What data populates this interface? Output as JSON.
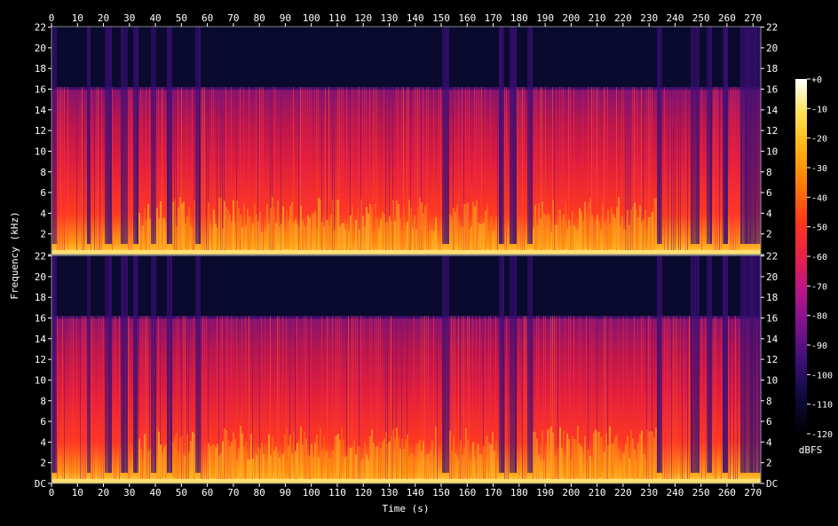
{
  "chart_data": {
    "type": "heatmap",
    "title": "",
    "xlabel": "Time (s)",
    "ylabel": "Frequency (kHz)",
    "colorbar_label": "dBFS",
    "xlim": [
      0,
      273
    ],
    "ylim": [
      0,
      22.05
    ],
    "x_ticks": [
      0,
      10,
      20,
      30,
      40,
      50,
      60,
      70,
      80,
      90,
      100,
      110,
      120,
      130,
      140,
      150,
      160,
      170,
      180,
      190,
      200,
      210,
      220,
      230,
      240,
      250,
      260,
      270
    ],
    "y_ticks": [
      {
        "value": 0,
        "label": "DC"
      },
      {
        "value": 2,
        "label": "2"
      },
      {
        "value": 4,
        "label": "4"
      },
      {
        "value": 6,
        "label": "6"
      },
      {
        "value": 8,
        "label": "8"
      },
      {
        "value": 10,
        "label": "10"
      },
      {
        "value": 12,
        "label": "12"
      },
      {
        "value": 14,
        "label": "14"
      },
      {
        "value": 16,
        "label": "16"
      },
      {
        "value": 18,
        "label": "18"
      },
      {
        "value": 20,
        "label": "20"
      },
      {
        "value": 22,
        "label": "22"
      }
    ],
    "colorbar": {
      "range": [
        -120,
        0
      ],
      "ticks": [
        {
          "value": 0,
          "label": "+0"
        },
        {
          "value": -10,
          "label": "-10"
        },
        {
          "value": -20,
          "label": "-20"
        },
        {
          "value": -30,
          "label": "-30"
        },
        {
          "value": -40,
          "label": "-40"
        },
        {
          "value": -50,
          "label": "-50"
        },
        {
          "value": -60,
          "label": "-60"
        },
        {
          "value": -70,
          "label": "-70"
        },
        {
          "value": -80,
          "label": "-80"
        },
        {
          "value": -90,
          "label": "-90"
        },
        {
          "value": -100,
          "label": "-100"
        },
        {
          "value": -110,
          "label": "-110"
        },
        {
          "value": -120,
          "label": "-120"
        }
      ],
      "colors": [
        "#000000",
        "#0c0a3a",
        "#3a0f74",
        "#7a1190",
        "#b8158a",
        "#e8204a",
        "#ff3a18",
        "#ff7a08",
        "#ffb010",
        "#ffe050",
        "#ffffff"
      ]
    },
    "channels": 2,
    "upper_cutoff_khz": 16.2,
    "quiet_segments_s": [
      [
        0,
        2
      ],
      [
        13,
        15
      ],
      [
        20,
        23
      ],
      [
        26,
        29
      ],
      [
        31,
        33
      ],
      [
        38,
        40
      ],
      [
        44,
        46
      ],
      [
        55,
        57
      ],
      [
        150,
        153
      ],
      [
        172,
        174
      ],
      [
        176,
        179
      ],
      [
        183,
        185
      ],
      [
        233,
        235
      ],
      [
        246,
        249
      ],
      [
        252,
        254
      ],
      [
        258,
        260
      ],
      [
        265,
        273
      ]
    ],
    "loud_segments_s": [
      [
        32,
        44
      ],
      [
        46,
        55
      ],
      [
        60,
        148
      ],
      [
        153,
        171
      ],
      [
        185,
        233
      ]
    ],
    "colorscale": "dBFS"
  }
}
